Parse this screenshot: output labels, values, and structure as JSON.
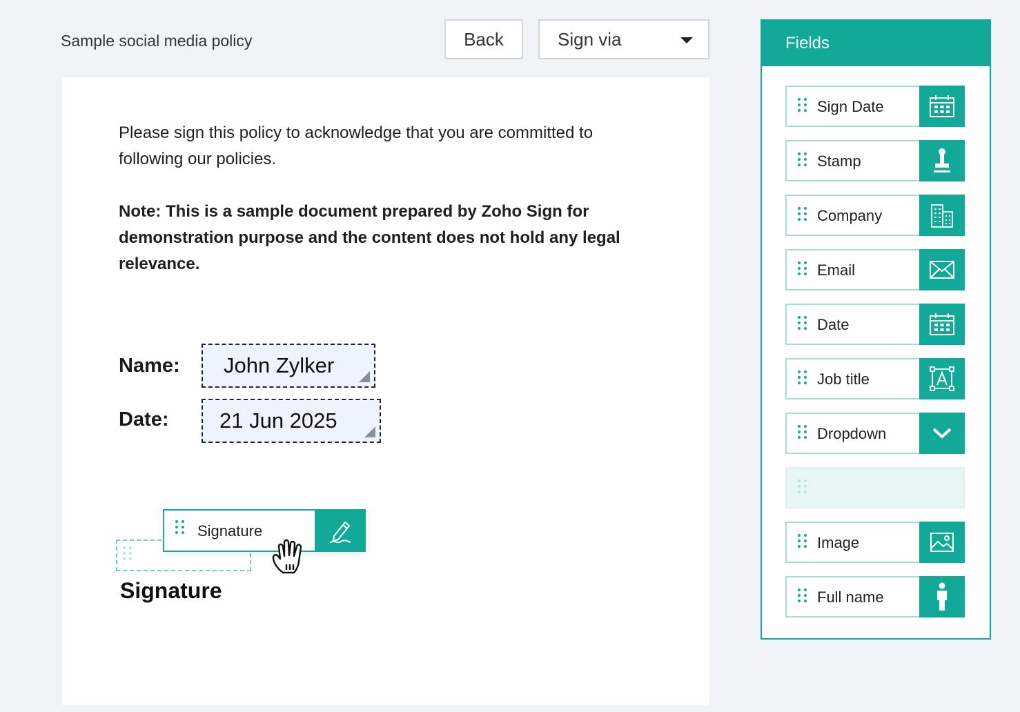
{
  "header": {
    "document_title": "Sample social media policy",
    "back_label": "Back",
    "sign_via_label": "Sign via"
  },
  "document": {
    "paragraph1": "Please sign this policy to acknowledge that you are committed to following our policies.",
    "paragraph2": "Note: This is a sample document prepared by Zoho Sign for demonstration purpose and the content does not hold any legal relevance.",
    "name_label": "Name:",
    "name_value": "John Zylker",
    "date_label": "Date:",
    "date_value": "21 Jun 2025",
    "signature_label": "Signature"
  },
  "drag_chip": {
    "label": "Signature",
    "icon": "signature-pen-icon"
  },
  "fields_panel": {
    "title": "Fields",
    "items": [
      {
        "label": "Sign Date",
        "icon": "calendar-icon"
      },
      {
        "label": "Stamp",
        "icon": "stamp-icon"
      },
      {
        "label": "Company",
        "icon": "building-icon"
      },
      {
        "label": "Email",
        "icon": "envelope-icon"
      },
      {
        "label": "Date",
        "icon": "calendar-icon"
      },
      {
        "label": "Job title",
        "icon": "text-box-icon"
      },
      {
        "label": "Dropdown",
        "icon": "chevron-down-icon"
      },
      {
        "label": "",
        "icon": ""
      },
      {
        "label": "Image",
        "icon": "image-icon"
      },
      {
        "label": "Full name",
        "icon": "person-icon"
      }
    ]
  },
  "colors": {
    "accent": "#12a999",
    "background": "#f1f3f7",
    "field_fill": "#eef3fd"
  }
}
